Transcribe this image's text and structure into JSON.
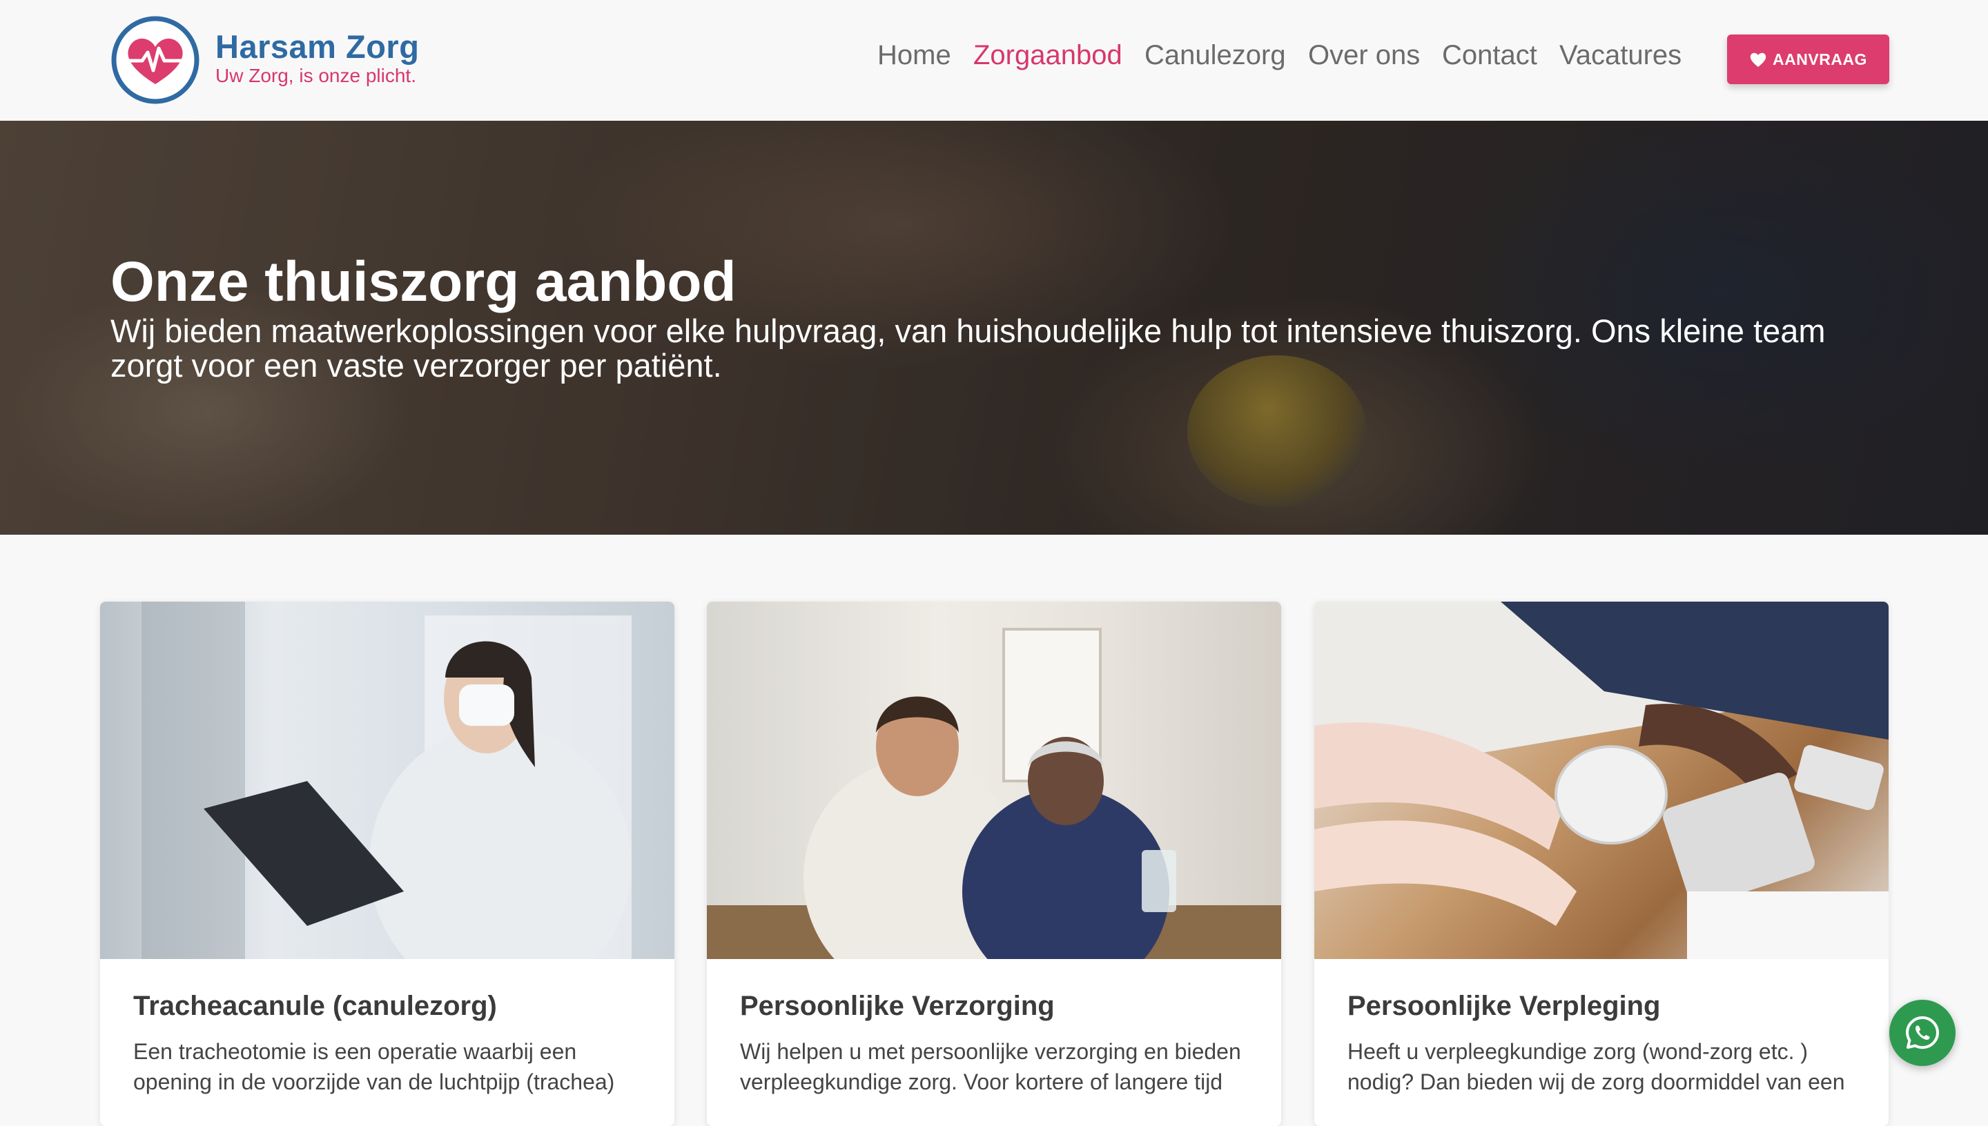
{
  "brand": {
    "name": "Harsam Zorg",
    "tagline": "Uw Zorg, is onze plicht."
  },
  "nav": {
    "items": [
      {
        "label": "Home",
        "active": false
      },
      {
        "label": "Zorgaanbod",
        "active": true
      },
      {
        "label": "Canulezorg",
        "active": false
      },
      {
        "label": "Over ons",
        "active": false
      },
      {
        "label": "Contact",
        "active": false
      },
      {
        "label": "Vacatures",
        "active": false
      }
    ],
    "cta_label": "AANVRAAG"
  },
  "hero": {
    "title": "Onze thuiszorg aanbod",
    "text": "Wij bieden maatwerkoplossingen voor elke hulpvraag, van huishoudelijke hulp tot intensieve thuiszorg. Ons kleine team zorgt voor een vaste verzorger per patiënt."
  },
  "cards": [
    {
      "title": "Tracheacanule (canulezorg)",
      "text": "Een tracheotomie is een operatie waarbij een opening in de voorzijde van de luchtpijp (trachea)"
    },
    {
      "title": "Persoonlijke Verzorging",
      "text": "Wij helpen u met persoonlijke verzorging en bieden verpleegkundige zorg. Voor kortere of langere tijd"
    },
    {
      "title": "Persoonlijke Verpleging",
      "text": "Heeft u verpleegkundige zorg (wond-zorg etc. ) nodig? Dan bieden wij de zorg doormiddel van een"
    }
  ],
  "colors": {
    "brand_blue": "#2f6aa3",
    "accent_pink": "#dc3d6e",
    "whatsapp_green": "#2e9a4f"
  },
  "icons": [
    "heart-ecg-logo-icon",
    "heart-icon",
    "whatsapp-icon"
  ]
}
